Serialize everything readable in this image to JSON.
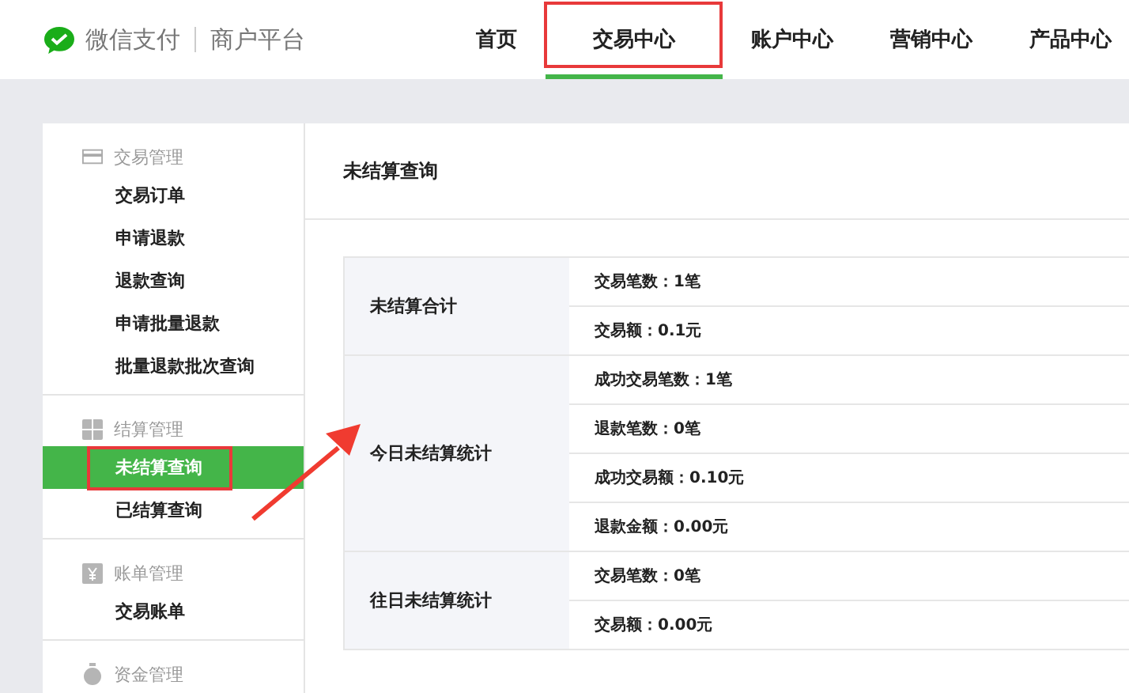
{
  "header": {
    "brand": "微信支付",
    "platform": "商户平台",
    "tabs": [
      {
        "label": "首页",
        "selected": false,
        "annotated": false
      },
      {
        "label": "交易中心",
        "selected": true,
        "annotated": true
      },
      {
        "label": "账户中心",
        "selected": false,
        "annotated": false
      },
      {
        "label": "营销中心",
        "selected": false,
        "annotated": false
      },
      {
        "label": "产品中心",
        "selected": false,
        "annotated": false
      }
    ]
  },
  "sidebar": {
    "groups": [
      {
        "kind": "card",
        "title": "交易管理",
        "items": [
          {
            "label": "交易订单",
            "selected": false,
            "annotated": false
          },
          {
            "label": "申请退款",
            "selected": false,
            "annotated": false
          },
          {
            "label": "退款查询",
            "selected": false,
            "annotated": false
          },
          {
            "label": "申请批量退款",
            "selected": false,
            "annotated": false
          },
          {
            "label": "批量退款批次查询",
            "selected": false,
            "annotated": false
          }
        ]
      },
      {
        "kind": "grid",
        "title": "结算管理",
        "items": [
          {
            "label": "未结算查询",
            "selected": true,
            "annotated": true
          },
          {
            "label": "已结算查询",
            "selected": false,
            "annotated": false
          }
        ]
      },
      {
        "kind": "yuan",
        "title": "账单管理",
        "items": [
          {
            "label": "交易账单",
            "selected": false,
            "annotated": false
          }
        ]
      },
      {
        "kind": "bag",
        "title": "资金管理"
      }
    ]
  },
  "content": {
    "title": "未结算查询",
    "table": {
      "rows": [
        {
          "label": "未结算合计",
          "values": [
            "交易笔数：1笔",
            "交易额：0.1元"
          ]
        },
        {
          "label": "今日未结算统计",
          "values": [
            "成功交易笔数：1笔",
            "退款笔数：0笔",
            "成功交易额：0.10元",
            "退款金额：0.00元"
          ]
        },
        {
          "label": "往日未结算统计",
          "values": [
            "交易笔数：0笔",
            "交易额：0.00元"
          ]
        }
      ]
    }
  }
}
